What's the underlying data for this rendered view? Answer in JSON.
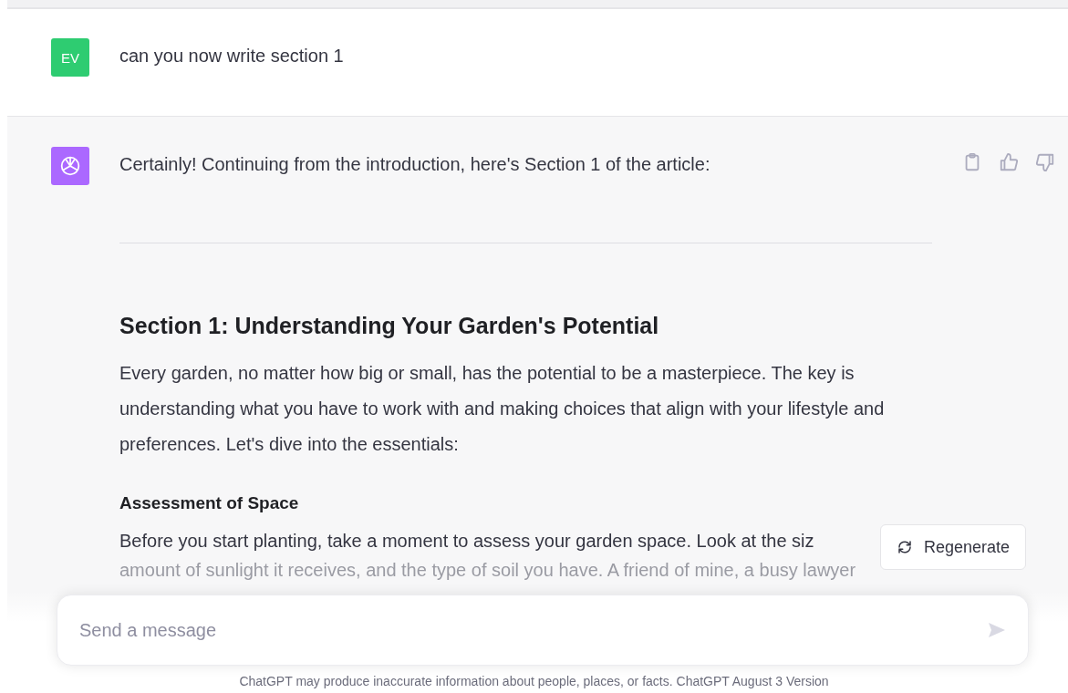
{
  "user_message": {
    "avatar": "EV",
    "text": "can you now write section 1"
  },
  "assistant_message": {
    "intro": "Certainly! Continuing from the introduction, here's Section 1 of the article:",
    "heading": "Section 1: Understanding Your Garden's Potential",
    "paragraph": "Every garden, no matter how big or small, has the potential to be a masterpiece. The key is understanding what you have to work with and making choices that align with your lifestyle and preferences. Let's dive into the essentials:",
    "subheading": "Assessment of Space",
    "lines": [
      "Before you start planting, take a moment to assess your garden space. Look at the siz",
      "amount of sunlight it receives, and the type of soil you have. A friend of mine, a busy lawyer"
    ]
  },
  "regenerate_button": "Regenerate",
  "composer": {
    "placeholder": "Send a message"
  },
  "footer": "ChatGPT may produce inaccurate information about people, places, or facts. ChatGPT August 3 Version"
}
